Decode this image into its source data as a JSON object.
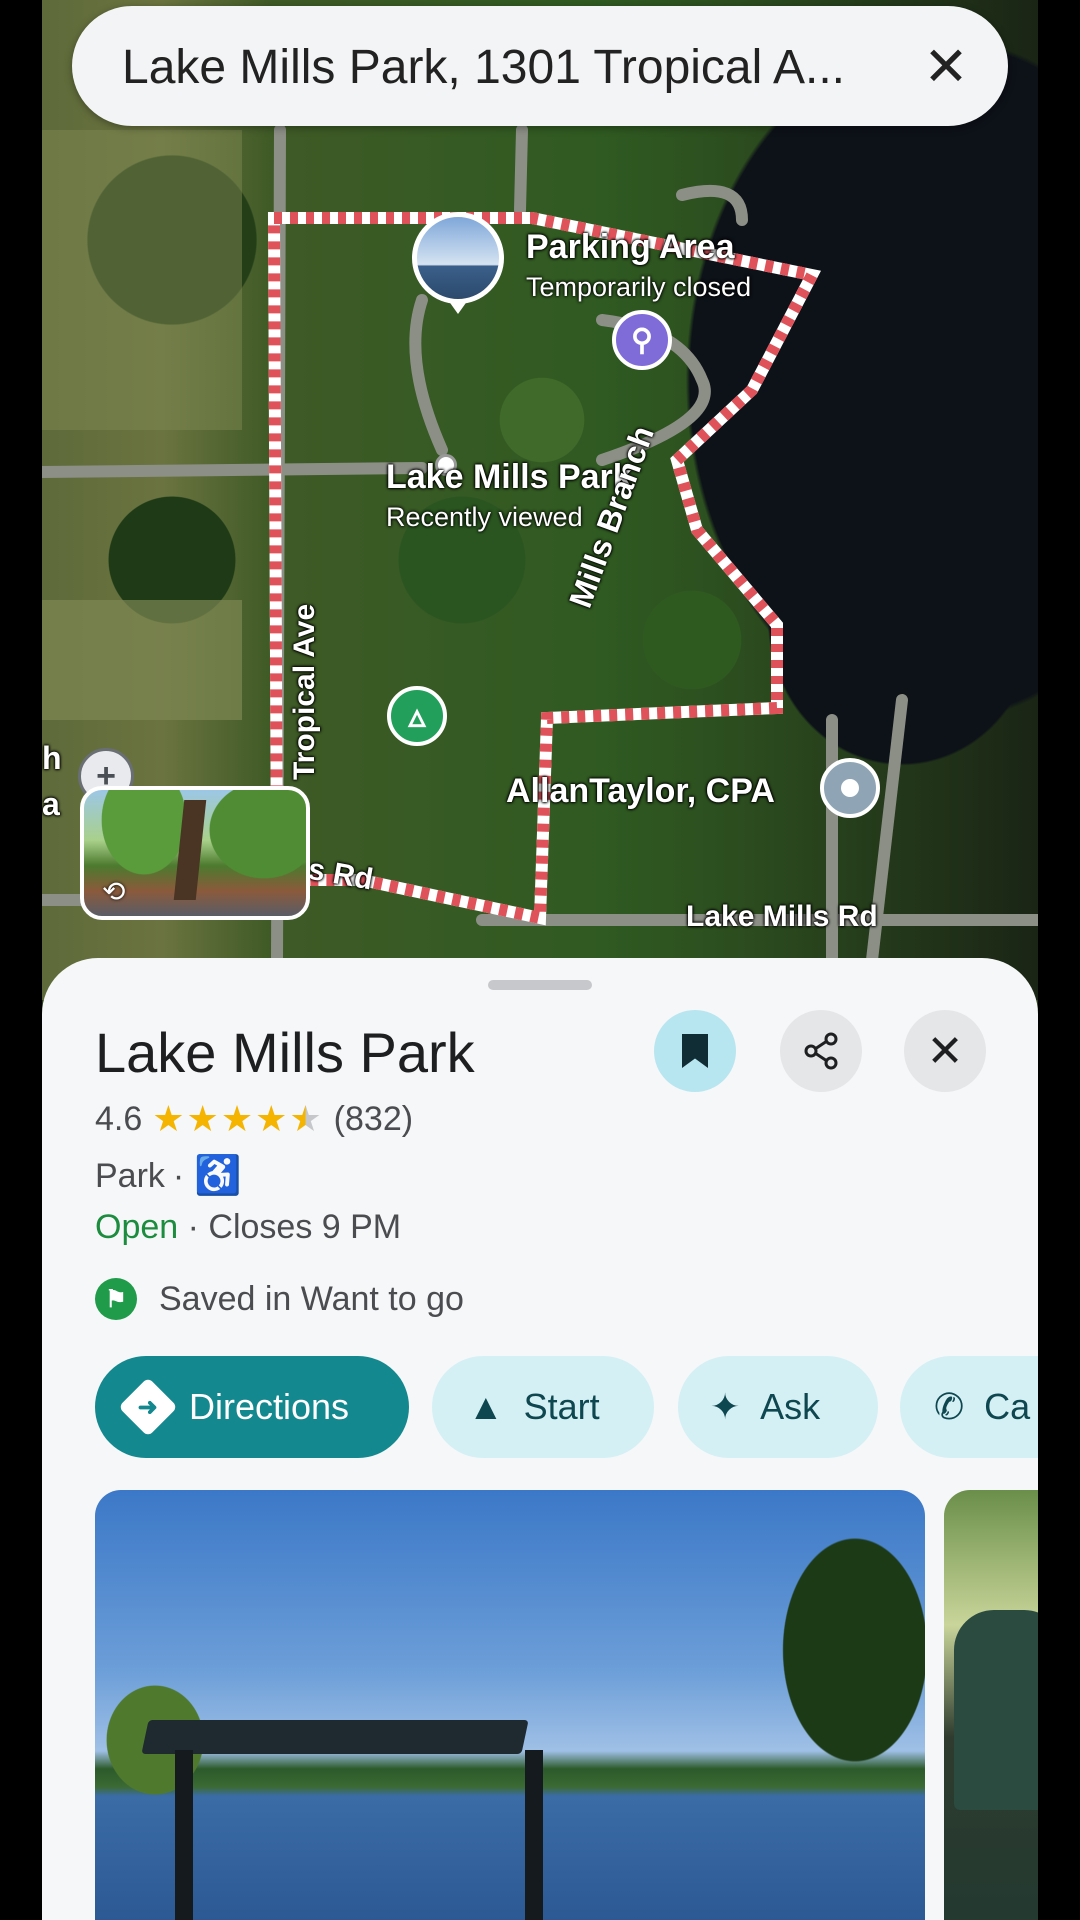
{
  "search": {
    "query": "Lake Mills Park, 1301 Tropical A..."
  },
  "map": {
    "labels": {
      "parking_area": "Parking Area",
      "parking_status": "Temporarily closed",
      "park_name": "Lake Mills Park",
      "park_sub": "Recently viewed",
      "stream": "Mills Branch",
      "road_tropical": "Tropical Ave",
      "road_rd_left": "s Rd",
      "road_lake_mills": "Lake Mills Rd",
      "business": "AllanTaylor, CPA",
      "edge_h": "h",
      "edge_a": "a"
    },
    "icons": [
      "restroom-icon",
      "campground-icon",
      "place-pin-icon",
      "compass-icon",
      "street-view-icon"
    ]
  },
  "place": {
    "title": "Lake Mills Park",
    "rating": "4.6",
    "rating_value": 4.6,
    "reviews": "(832)",
    "type": "Park",
    "type_sep": "·",
    "hours_status": "Open",
    "hours_detail": " · Closes 9 PM",
    "saved_text": "Saved in Want to go"
  },
  "actions": {
    "directions": "Directions",
    "start": "Start",
    "ask": "Ask",
    "call": "Ca"
  },
  "colors": {
    "accent_teal": "#14888f",
    "chip_bg": "#d4f0f4",
    "open_green": "#1c8c3e",
    "star_gold": "#f4b400",
    "boundary_red": "#e0525a"
  }
}
